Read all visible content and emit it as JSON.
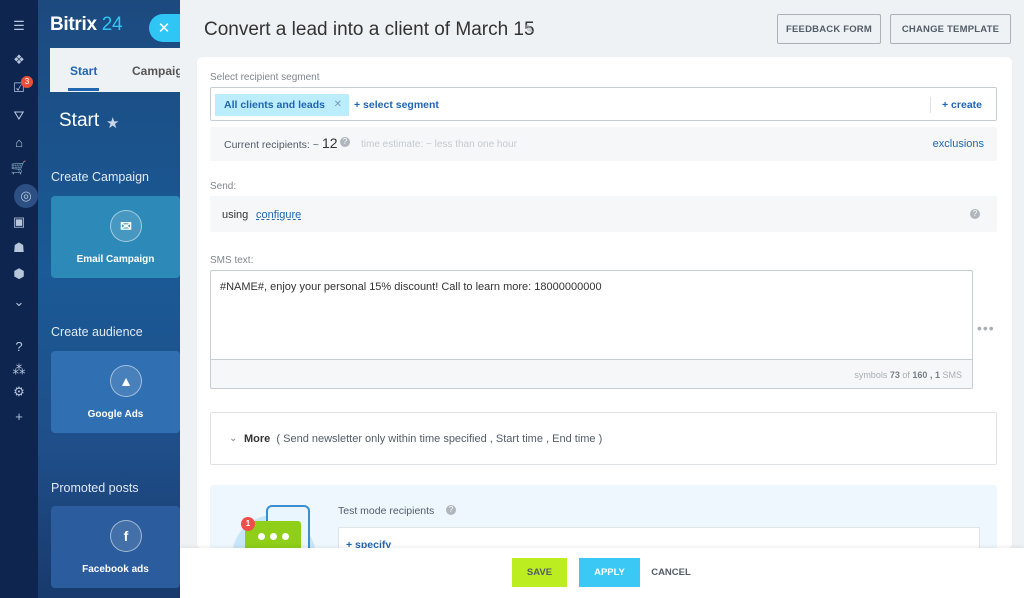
{
  "app": {
    "logo_name": "Bitrix",
    "logo_number": "24",
    "notification_count": "3",
    "close_glyph": "✕"
  },
  "background": {
    "tabs": [
      "Start",
      "Campaign"
    ],
    "page_title": "Start",
    "sections": [
      {
        "label": "Create Campaign",
        "tile": "Email Campaign",
        "icon": "email-icon"
      },
      {
        "label": "Create audience",
        "tile": "Google Ads",
        "icon": "google-ads-icon"
      },
      {
        "label": "Promoted posts",
        "tile": "Facebook ads",
        "icon": "facebook-icon"
      }
    ]
  },
  "header": {
    "title": "Convert a lead into a client of March 15",
    "feedback_label": "FEEDBACK FORM",
    "change_template_label": "CHANGE TEMPLATE"
  },
  "segment": {
    "label": "Select recipient segment",
    "chip": "All clients and leads",
    "select_label": "+ select segment",
    "create_label": "+ create"
  },
  "recipients": {
    "label": "Current recipients: ~",
    "count": "12",
    "estimate": "time estimate: ~ less than one hour",
    "exclusions_label": "exclusions"
  },
  "send": {
    "label": "Send:",
    "using": "using",
    "configure_label": "configure"
  },
  "sms": {
    "label": "SMS text:",
    "text": "#NAME#, enjoy your personal 15% discount! Call to learn more: 18000000000",
    "symbols_prefix": "symbols",
    "symbols_count": "73",
    "symbols_of": "of",
    "symbols_max": "160",
    "sms_count": ", 1",
    "sms_unit": "SMS"
  },
  "more": {
    "label": "More",
    "details": "( Send newsletter only within time specified ,  Start time ,  End time )"
  },
  "test": {
    "label": "Test mode recipients",
    "specify_label": "+ specify",
    "badge": "1"
  },
  "footer": {
    "save_label": "SAVE",
    "apply_label": "APPLY",
    "cancel_label": "CANCEL"
  },
  "colors": {
    "accent_blue": "#2066b0",
    "save_green": "#bbed21",
    "apply_cyan": "#3bc8f5",
    "chip_bg": "#bcedfc"
  }
}
